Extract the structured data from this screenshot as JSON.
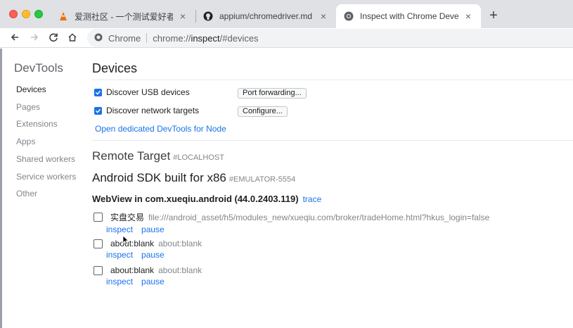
{
  "tabs": [
    {
      "title": "爱测社区 - 一个测试爱好者的技",
      "favicon": "testerhome-icon",
      "active": false
    },
    {
      "title": "appium/chromedriver.md at m",
      "favicon": "github-icon",
      "active": false
    },
    {
      "title": "Inspect with Chrome Develope",
      "favicon": "chrome-icon",
      "active": true
    }
  ],
  "omnibox": {
    "label": "Chrome",
    "url_prefix": "chrome://",
    "url_host": "inspect",
    "url_suffix": "/#devices"
  },
  "sidebar": {
    "title": "DevTools",
    "items": [
      {
        "label": "Devices",
        "active": true
      },
      {
        "label": "Pages",
        "active": false
      },
      {
        "label": "Extensions",
        "active": false
      },
      {
        "label": "Apps",
        "active": false
      },
      {
        "label": "Shared workers",
        "active": false
      },
      {
        "label": "Service workers",
        "active": false
      },
      {
        "label": "Other",
        "active": false
      }
    ]
  },
  "devices": {
    "heading": "Devices",
    "usb_label": "Discover USB devices",
    "usb_checked": true,
    "port_forwarding_btn": "Port forwarding...",
    "network_label": "Discover network targets",
    "network_checked": true,
    "configure_btn": "Configure...",
    "node_link": "Open dedicated DevTools for Node"
  },
  "remote": {
    "heading": "Remote Target",
    "tag": "#LOCALHOST"
  },
  "device": {
    "name": "Android SDK built for x86",
    "serial": "#EMULATOR-5554"
  },
  "browser": {
    "label": "WebView in com.xueqiu.android (44.0.2403.119)",
    "trace_link": "trace"
  },
  "targets": [
    {
      "name": "实盘交易",
      "url": "file:///android_asset/h5/modules_new/xueqiu.com/broker/tradeHome.html?hkus_login=false",
      "inspect": "inspect",
      "pause": "pause"
    },
    {
      "name": "about:blank",
      "url": "about:blank",
      "inspect": "inspect",
      "pause": "pause"
    },
    {
      "name": "about:blank",
      "url": "about:blank",
      "inspect": "inspect",
      "pause": "pause"
    }
  ],
  "colors": {
    "link": "#1a73e8",
    "checkbox": "#1a73e8",
    "tabstrip": "#dfe1e5"
  }
}
